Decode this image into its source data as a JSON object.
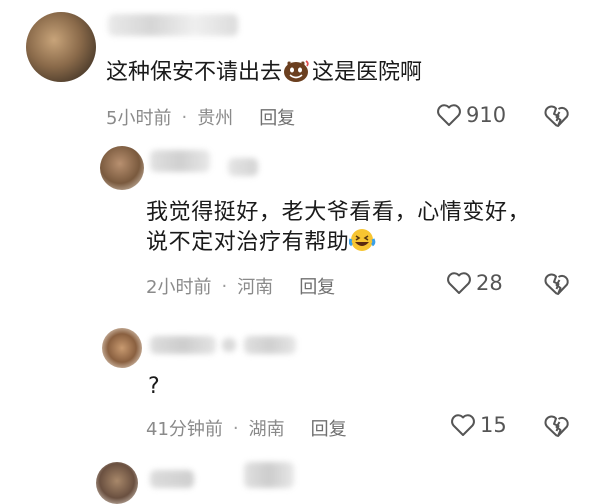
{
  "comments": [
    {
      "text_before": "这种保安不请出去",
      "text_after": "这是医院啊",
      "emoji": "laughing-devil-emoji",
      "time": "5小时前",
      "location": "贵州",
      "reply_label": "回复",
      "likes": "910"
    },
    {
      "line1": "我觉得挺好，老大爷看看，心情变好，",
      "line2": "说不定对治疗有帮助",
      "emoji": "laughing-crying-emoji",
      "time": "2小时前",
      "location": "河南",
      "reply_label": "回复",
      "likes": "28"
    },
    {
      "text": "?",
      "time": "41分钟前",
      "location": "湖南",
      "reply_label": "回复",
      "likes": "15"
    }
  ],
  "separator": "·",
  "icons": {
    "like": "heart-outline-icon",
    "dislike": "broken-heart-icon"
  },
  "colors": {
    "meta": "#8a8a8a",
    "text": "#1a1a1a"
  }
}
